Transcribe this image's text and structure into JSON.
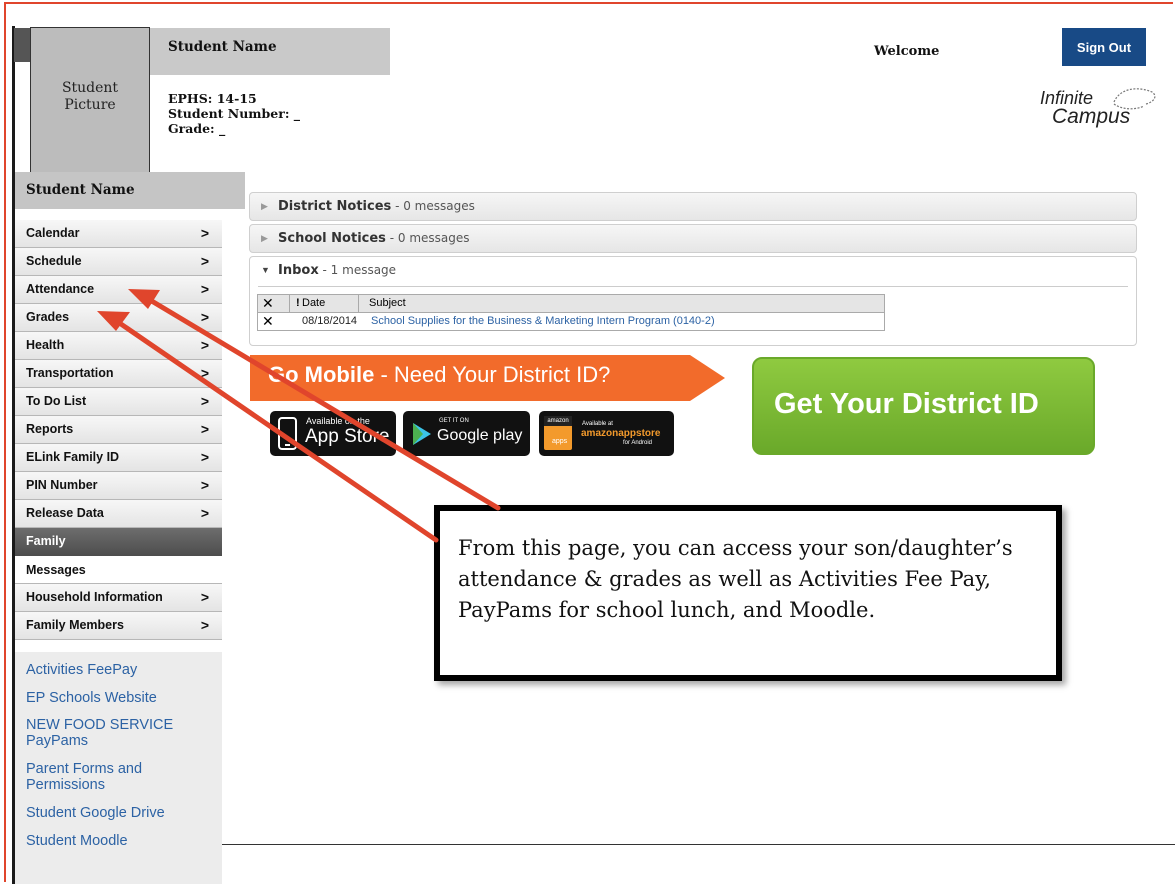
{
  "header": {
    "photo_line1": "Student",
    "photo_line2": "Picture",
    "student_name": "Student Name",
    "school_year": "EPHS: 14-15",
    "student_number": "Student Number: _",
    "grade": "Grade:  _",
    "welcome": "Welcome",
    "sign_out": "Sign Out",
    "logo_line1": "Infinite",
    "logo_line2": "Campus"
  },
  "sidebar": {
    "student_name": "Student Name",
    "items": [
      {
        "label": "Calendar",
        "chevron": ">"
      },
      {
        "label": "Schedule",
        "chevron": ">"
      },
      {
        "label": "Attendance",
        "chevron": ">"
      },
      {
        "label": "Grades",
        "chevron": ">"
      },
      {
        "label": "Health",
        "chevron": ">"
      },
      {
        "label": "Transportation",
        "chevron": ">"
      },
      {
        "label": "To Do List",
        "chevron": ">"
      },
      {
        "label": "Reports",
        "chevron": ">"
      },
      {
        "label": "ELink Family ID",
        "chevron": ">"
      },
      {
        "label": "PIN Number",
        "chevron": ">"
      },
      {
        "label": "Release Data",
        "chevron": ">"
      }
    ],
    "family_section": "Family",
    "family_items": [
      {
        "label": "Messages",
        "chevron": ""
      },
      {
        "label": "Household Information",
        "chevron": ">"
      },
      {
        "label": "Family Members",
        "chevron": ">"
      }
    ],
    "links": [
      "Activities FeePay",
      "EP Schools Website",
      "NEW FOOD SERVICE PayPams",
      "Parent Forms and Permissions",
      "Student Google Drive",
      "Student Moodle"
    ]
  },
  "notices": {
    "district_title": "District Notices",
    "district_count": " - 0 messages",
    "school_title": "School Notices",
    "school_count": " - 0 messages",
    "inbox_title": "Inbox",
    "inbox_count": " - 1 message"
  },
  "inbox_table": {
    "col_flag": "!",
    "col_date": "Date",
    "col_subject": "Subject",
    "rows": [
      {
        "date": "08/18/2014",
        "subject": "School Supplies for the Business & Marketing Intern Program (0140-2)"
      }
    ]
  },
  "promo": {
    "go_mobile": "Go Mobile",
    "go_mobile_rest": " - Need Your District ID?",
    "app_store_small": "Available on the",
    "app_store_big": "App Store",
    "google_small": "GET IT ON",
    "google_big": "Google play",
    "amazon_small": "Available at",
    "amazon_big": "amazonappstore",
    "amazon_sub": "for Android",
    "amazon_logo": "amazon",
    "amazon_apps": "apps",
    "get_id": "Get Your District ID"
  },
  "callout": {
    "text": "From this page, you can access your son/daughter’s attendance & grades as well as Activities Fee Pay, PayPams for school lunch, and Moodle."
  },
  "colors": {
    "annotation_red": "#e0452c",
    "signout_blue": "#184a86",
    "link_blue": "#2c62a4",
    "promo_orange": "#f26b2b",
    "promo_green": "#7cbb34"
  }
}
